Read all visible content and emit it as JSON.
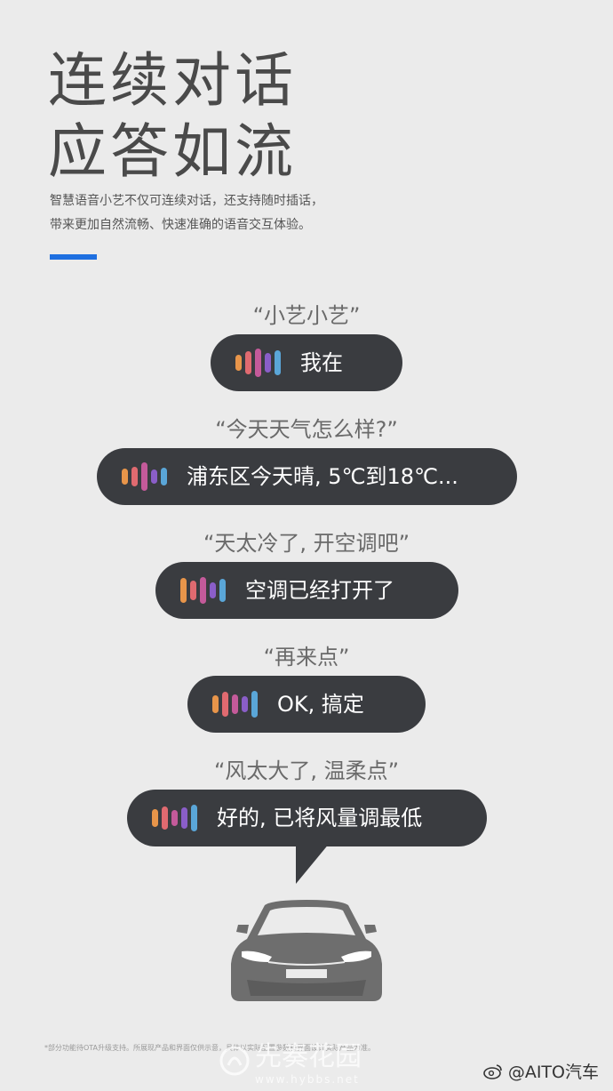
{
  "header": {
    "title_line1": "连续对话",
    "title_line2": "应答如流",
    "subtitle_line1": "智慧语音小艺不仅可连续对话，还支持随时插话，",
    "subtitle_line2": "带来更加自然流畅、快速准确的语音交互体验。"
  },
  "colors": {
    "accent": "#1e6fe0",
    "bubble": "#3a3c40",
    "background": "#ebebeb",
    "wave": [
      "#e8954a",
      "#e06a70",
      "#c45a9a",
      "#8a5ec8",
      "#5aa6d8"
    ]
  },
  "dialogue": [
    {
      "query": "“小艺小艺”",
      "reply": "我在"
    },
    {
      "query": "“今天天气怎么样?”",
      "reply": "浦东区今天晴, 5℃到18℃..."
    },
    {
      "query": "“天太冷了, 开空调吧”",
      "reply": "空调已经打开了"
    },
    {
      "query": "“再来点”",
      "reply": "OK, 搞定"
    },
    {
      "query": "“风太大了, 温柔点”",
      "reply": "好的, 已将风量调最低"
    }
  ],
  "footer": {
    "disclaimer": "*部分功能待OTA升级支持。所展现产品和界面仅供示意，具体以实际配置参数和界面设计实际产品为准。",
    "watermark_main": "先奏花园",
    "watermark_sub": "www.hybbs.net",
    "credit": "@AITO汽车"
  },
  "icons": [
    "voice-wave-icon",
    "car-front-icon",
    "weibo-icon"
  ]
}
